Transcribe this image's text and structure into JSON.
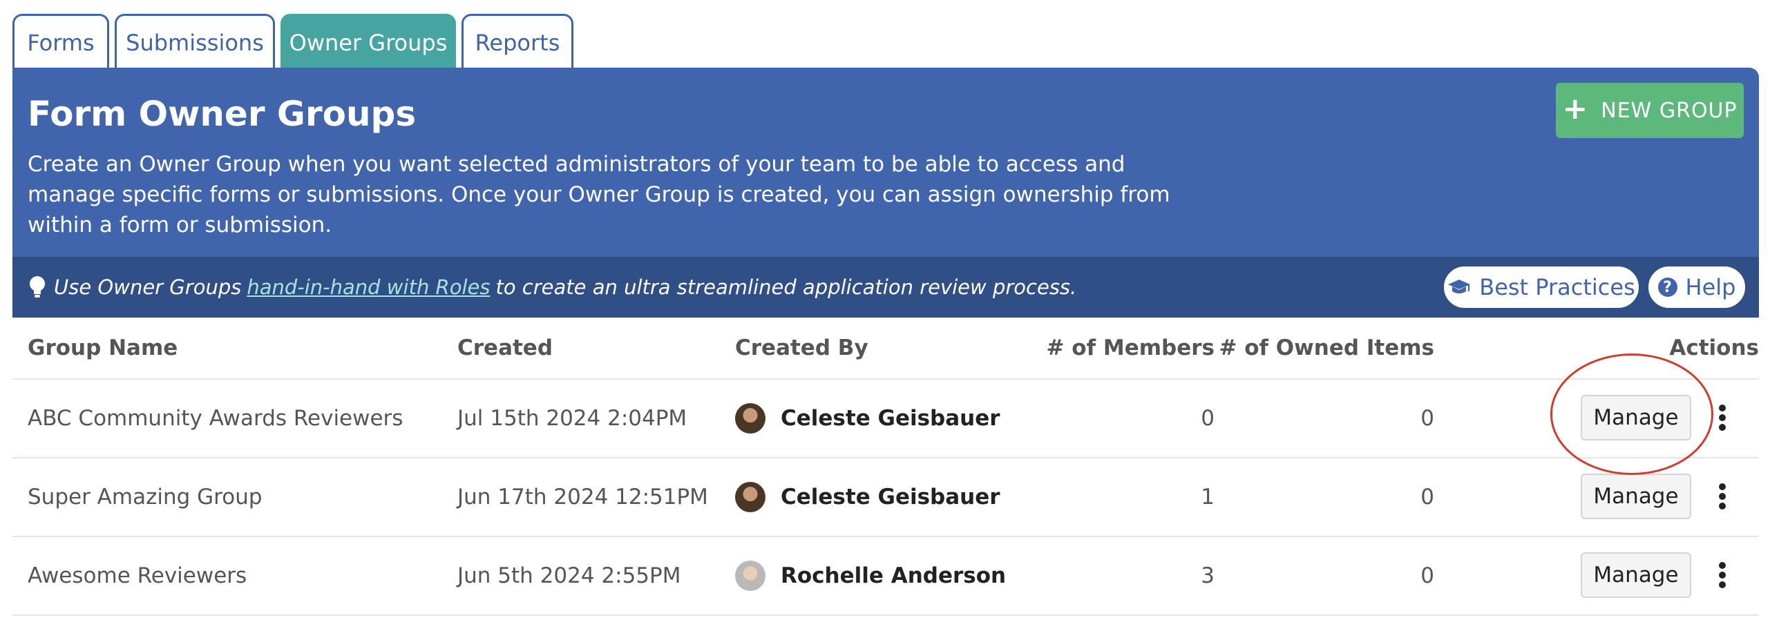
{
  "tabs": [
    {
      "label": "Forms",
      "active": false
    },
    {
      "label": "Submissions",
      "active": false
    },
    {
      "label": "Owner Groups",
      "active": true
    },
    {
      "label": "Reports",
      "active": false
    }
  ],
  "header": {
    "title": "Form Owner Groups",
    "description": "Create an Owner Group when you want selected administrators of your team to be able to access and manage specific forms or submissions. Once your Owner Group is created, you can assign ownership from within a form or submission.",
    "new_group_label": "NEW GROUP",
    "background_color": "#4065ad",
    "button_color": "#5cb87b"
  },
  "tip": {
    "prefix": "Use Owner Groups",
    "link": "hand-in-hand with Roles",
    "suffix": "to create an ultra streamlined application review process.",
    "best_practices_label": "Best Practices",
    "help_label": "Help"
  },
  "table": {
    "headers": [
      "Group Name",
      "Created",
      "Created By",
      "# of Members",
      "# of Owned Items",
      "Actions"
    ],
    "rows": [
      {
        "name": "ABC Community Awards Reviewers",
        "created": "Jul 15th 2024 2:04PM",
        "created_by": "Celeste Geisbauer",
        "members": "0",
        "owned": "0",
        "action": "Manage"
      },
      {
        "name": "Super Amazing Group",
        "created": "Jun 17th 2024 12:51PM",
        "created_by": "Celeste Geisbauer",
        "members": "1",
        "owned": "0",
        "action": "Manage"
      },
      {
        "name": "Awesome Reviewers",
        "created": "Jun 5th 2024 2:55PM",
        "created_by": "Rochelle Anderson",
        "members": "3",
        "owned": "0",
        "action": "Manage"
      }
    ]
  },
  "icons": {
    "new_group": "plus-icon",
    "tip": "lightbulb-icon",
    "best_practices": "graduation-cap-icon",
    "help": "question-circle-icon",
    "row_menu": "kebab-menu-icon"
  },
  "annotation_color": "#d23b2a"
}
